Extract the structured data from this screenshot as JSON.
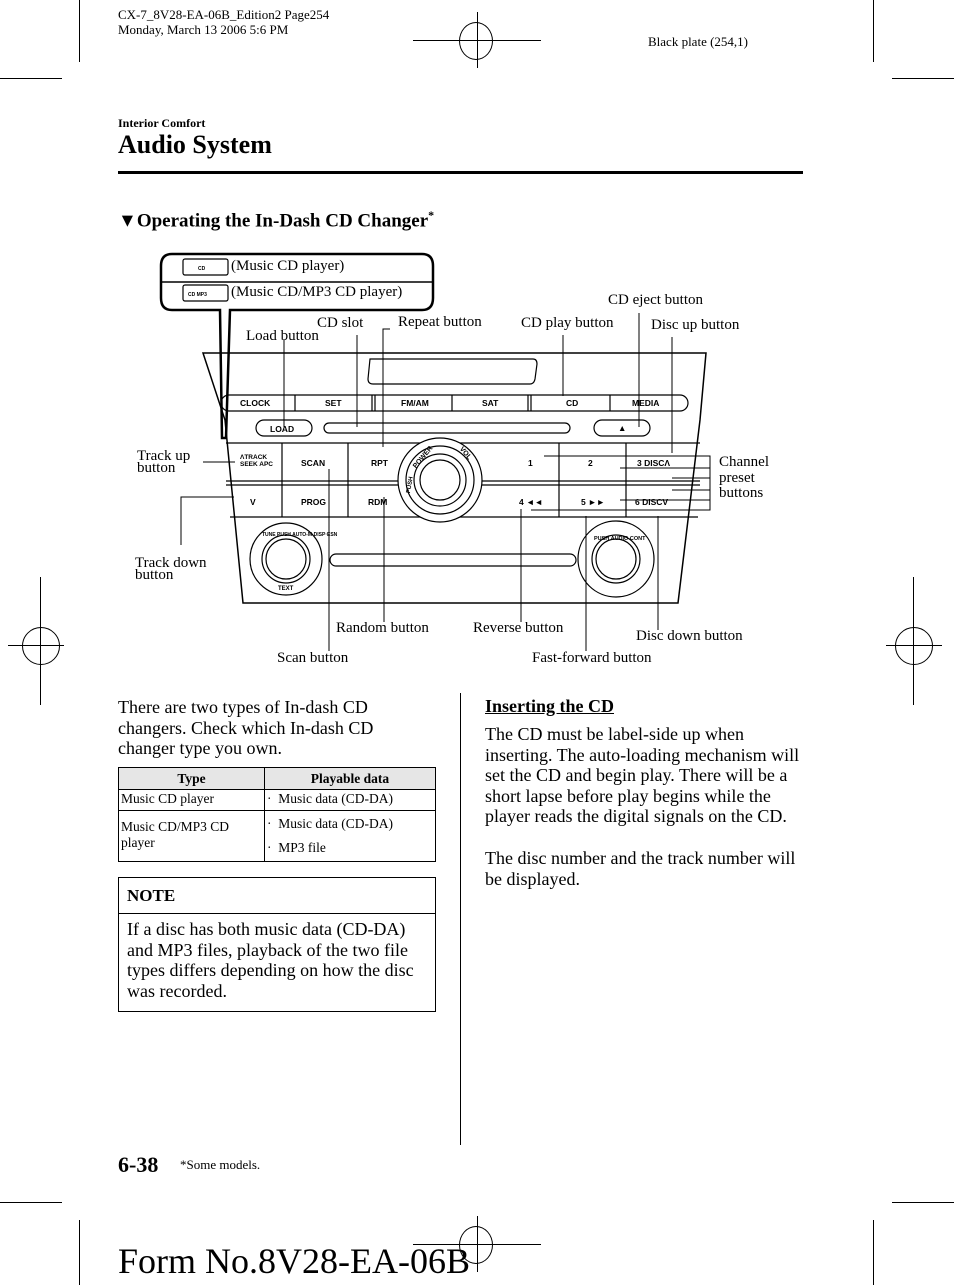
{
  "print_header": {
    "file_line": "CX-7_8V28-EA-06B_Edition2 Page254",
    "date_line": "Monday, March 13 2006 5:6 PM",
    "plate": "Black plate (254,1)"
  },
  "section_label": "Interior Comfort",
  "page_title": "Audio System",
  "subheading": {
    "marker": "▼",
    "text": "Operating the In-Dash CD Changer",
    "asterisk": "*"
  },
  "diagram": {
    "legend": [
      {
        "badge_icon": "music-cd-badge",
        "label": "(Music CD player)"
      },
      {
        "badge_icon": "music-cd-mp3-badge",
        "label": "(Music CD/MP3 CD player)"
      }
    ],
    "callouts": {
      "cd_eject": "CD eject button",
      "cd_slot": "CD slot",
      "repeat": "Repeat button",
      "cd_play": "CD play button",
      "disc_up": "Disc up button",
      "load": "Load button",
      "track_up": [
        "Track up",
        "button"
      ],
      "track_down": [
        "Track down",
        "button"
      ],
      "channel_preset": [
        "Channel",
        "preset",
        "buttons"
      ],
      "random": "Random button",
      "reverse": "Reverse button",
      "disc_down": "Disc down button",
      "scan": "Scan button",
      "fast_forward": "Fast-forward button"
    },
    "unit_labels": {
      "top_buttons": [
        "CLOCK",
        "SET",
        "FM/AM",
        "SAT",
        "CD",
        "MEDIA"
      ],
      "load": "LOAD",
      "eject": "▲",
      "track_up": [
        "ΛTRACK",
        "SEEK APC"
      ],
      "track_down": "V",
      "scan": "SCAN",
      "prog": "PROG",
      "rpt": "RPT",
      "rdm": "RDM",
      "knob_ring": [
        "POWER",
        "PUSH",
        "VOL"
      ],
      "presets": [
        "1",
        "2",
        "3 DISCΛ",
        "4 ◄◄",
        "5 ►►",
        "6 DISCV"
      ],
      "tune_knob": [
        "TUNE PUSH AUTO-M·DISP·ESN",
        "TEXT"
      ],
      "audio_knob": "PUSH AUDIO CONT"
    }
  },
  "intro_text": "There are two types of In-dash CD changers. Check which In-dash CD changer type you own.",
  "types_table": {
    "headers": [
      "Type",
      "Playable data"
    ],
    "rows": [
      {
        "type": "Music CD player",
        "data": [
          "Music data (CD-DA)"
        ]
      },
      {
        "type": "Music CD/MP3 CD player",
        "data": [
          "Music data (CD-DA)",
          "MP3 file"
        ]
      }
    ]
  },
  "note": {
    "title": "NOTE",
    "body": "If a disc has both music data (CD-DA) and MP3 files, playback of the two file types differs depending on how the disc was recorded."
  },
  "inserting": {
    "heading": "Inserting the CD",
    "para1": "The CD must be label-side up when inserting. The auto-loading mechanism will set the CD and begin play. There will be a short lapse before play begins while the player reads the digital signals on the CD.",
    "para2": "The disc number and the track number will be displayed."
  },
  "footer": {
    "page_number": "6-38",
    "footnote_mark": "*",
    "footnote": "Some models.",
    "form_no": "Form No.8V28-EA-06B"
  }
}
